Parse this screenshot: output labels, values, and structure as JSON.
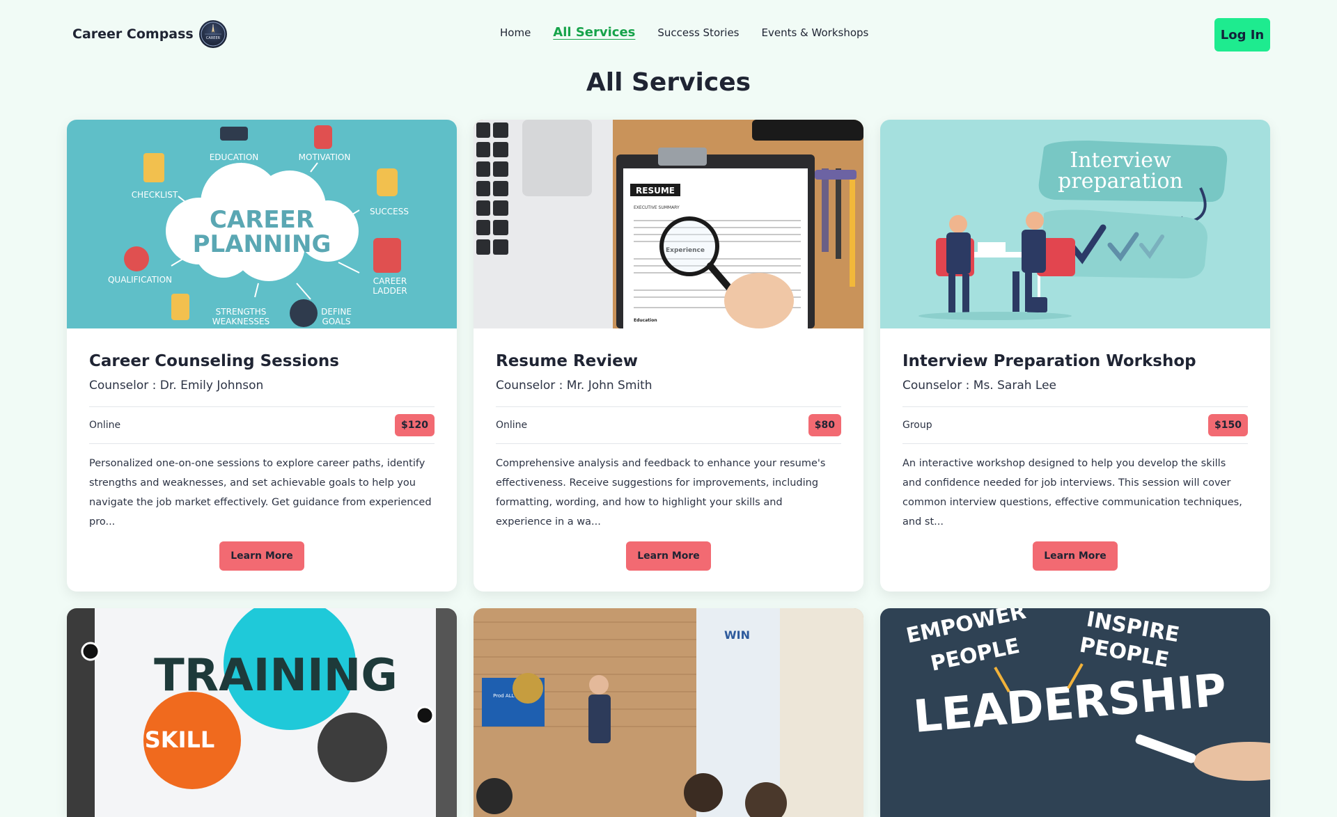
{
  "brand": {
    "name": "Career Compass",
    "logo_text": "CAREER"
  },
  "nav": {
    "links": [
      "Home",
      "All Services",
      "Success Stories",
      "Events & Workshops"
    ],
    "active": "All Services",
    "login_label": "Log In"
  },
  "page_title": "All Services",
  "colors": {
    "accent_green": "#1eeb8f",
    "price_badge": "#f26a72",
    "page_bg": "#f1fbf6"
  },
  "cards": [
    {
      "title": "Career Counseling Sessions",
      "counselor": "Counselor : Dr. Emily Johnson",
      "mode": "Online",
      "price": "$120",
      "description": "Personalized one-on-one sessions to explore career paths, identify strengths and weaknesses, and set achievable goals to help you navigate the job market effectively. Get guidance from experienced pro...",
      "button": "Learn More",
      "image": {
        "center1": "CAREER",
        "center2": "PLANNING",
        "labels": [
          "EDUCATION",
          "MOTIVATION",
          "CHECKLIST",
          "SUCCESS",
          "QUALIFICATION",
          "CAREER",
          "LADDER",
          "STRENGTHS",
          "WEAKNESSES",
          "DEFINE",
          "GOALS"
        ]
      }
    },
    {
      "title": "Resume Review",
      "counselor": "Counselor : Mr. John Smith",
      "mode": "Online",
      "price": "$80",
      "description": "Comprehensive analysis and feedback to enhance your resume's effectiveness. Receive suggestions for improvements, including formatting, wording, and how to highlight your skills and experience in a wa...",
      "button": "Learn More",
      "image": {
        "doc_title": "RESUME",
        "doc_sub": "EXECUTIVE SUMMARY",
        "section": "Experience",
        "section2": "Education"
      }
    },
    {
      "title": "Interview Preparation Workshop",
      "counselor": "Counselor : Ms. Sarah Lee",
      "mode": "Group",
      "price": "$150",
      "description": "An interactive workshop designed to help you develop the skills and confidence needed for job interviews. This session will cover common interview questions, effective communication techniques, and st...",
      "button": "Learn More",
      "image": {
        "line1": "Interview",
        "line2": "preparation"
      }
    }
  ],
  "row2_images": [
    {
      "word1": "TRAINING",
      "word2": "SKILL"
    },
    {
      "sign": "WIN",
      "screen": "Prod ALL HANDS"
    },
    {
      "word1": "EMPOWER",
      "word2": "PEOPLE",
      "word3": "INSPIRE",
      "word4": "PEOPLE",
      "word5": "LEADERSHIP"
    }
  ]
}
